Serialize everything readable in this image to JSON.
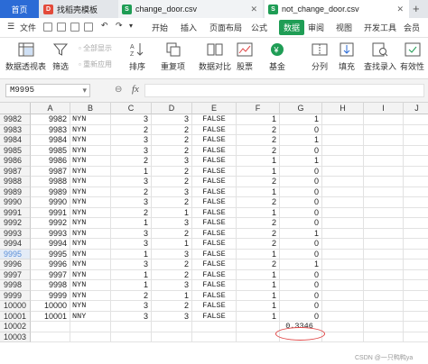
{
  "tabs": {
    "home": "首页",
    "t1": "找稻壳模板",
    "t2": "change_door.csv",
    "t3": "not_change_door.csv",
    "add": "+"
  },
  "menu": {
    "file": "文件",
    "items": [
      "开始",
      "插入",
      "页面布局",
      "公式",
      "数据",
      "审阅",
      "视图",
      "开发工具",
      "会员"
    ],
    "active_index": 4
  },
  "ribbon": {
    "pivot": "数据透视表",
    "filter": "筛选",
    "show_all": "全部显示",
    "reapply": "重新应用",
    "sort": "排序",
    "duplicates": "重复项",
    "compare": "数据对比",
    "stocks": "股票",
    "funds": "基金",
    "split": "分列",
    "fill": "填充",
    "lookup": "查找录入",
    "validity": "有效性"
  },
  "formula_bar": {
    "name_box": "M9995",
    "fx": "fx",
    "formula": ""
  },
  "columns": [
    "A",
    "B",
    "C",
    "D",
    "E",
    "F",
    "G",
    "H",
    "I",
    "J"
  ],
  "rows": [
    {
      "n": "9982",
      "a": "9982",
      "b": "NYN",
      "c": "3",
      "d": "3",
      "e": "FALSE",
      "f": "1",
      "g": "1"
    },
    {
      "n": "9983",
      "a": "9983",
      "b": "NYN",
      "c": "2",
      "d": "2",
      "e": "FALSE",
      "f": "2",
      "g": "0"
    },
    {
      "n": "9984",
      "a": "9984",
      "b": "NYN",
      "c": "3",
      "d": "2",
      "e": "FALSE",
      "f": "2",
      "g": "1"
    },
    {
      "n": "9985",
      "a": "9985",
      "b": "NYN",
      "c": "3",
      "d": "2",
      "e": "FALSE",
      "f": "2",
      "g": "0"
    },
    {
      "n": "9986",
      "a": "9986",
      "b": "NYN",
      "c": "2",
      "d": "3",
      "e": "FALSE",
      "f": "1",
      "g": "1"
    },
    {
      "n": "9987",
      "a": "9987",
      "b": "NYN",
      "c": "1",
      "d": "2",
      "e": "FALSE",
      "f": "1",
      "g": "0"
    },
    {
      "n": "9988",
      "a": "9988",
      "b": "NYN",
      "c": "3",
      "d": "2",
      "e": "FALSE",
      "f": "2",
      "g": "0"
    },
    {
      "n": "9989",
      "a": "9989",
      "b": "NYN",
      "c": "2",
      "d": "3",
      "e": "FALSE",
      "f": "1",
      "g": "0"
    },
    {
      "n": "9990",
      "a": "9990",
      "b": "NYN",
      "c": "3",
      "d": "2",
      "e": "FALSE",
      "f": "2",
      "g": "0"
    },
    {
      "n": "9991",
      "a": "9991",
      "b": "NYN",
      "c": "2",
      "d": "1",
      "e": "FALSE",
      "f": "1",
      "g": "0"
    },
    {
      "n": "9992",
      "a": "9992",
      "b": "NYN",
      "c": "1",
      "d": "3",
      "e": "FALSE",
      "f": "2",
      "g": "0"
    },
    {
      "n": "9993",
      "a": "9993",
      "b": "NYN",
      "c": "3",
      "d": "2",
      "e": "FALSE",
      "f": "2",
      "g": "1"
    },
    {
      "n": "9994",
      "a": "9994",
      "b": "NYN",
      "c": "3",
      "d": "1",
      "e": "FALSE",
      "f": "2",
      "g": "0"
    },
    {
      "n": "9995",
      "a": "9995",
      "b": "NYN",
      "c": "1",
      "d": "3",
      "e": "FALSE",
      "f": "1",
      "g": "0"
    },
    {
      "n": "9996",
      "a": "9996",
      "b": "NYN",
      "c": "3",
      "d": "2",
      "e": "FALSE",
      "f": "2",
      "g": "1"
    },
    {
      "n": "9997",
      "a": "9997",
      "b": "NYN",
      "c": "1",
      "d": "2",
      "e": "FALSE",
      "f": "1",
      "g": "0"
    },
    {
      "n": "9998",
      "a": "9998",
      "b": "NYN",
      "c": "1",
      "d": "3",
      "e": "FALSE",
      "f": "1",
      "g": "0"
    },
    {
      "n": "9999",
      "a": "9999",
      "b": "NYN",
      "c": "2",
      "d": "1",
      "e": "FALSE",
      "f": "1",
      "g": "0"
    },
    {
      "n": "10000",
      "a": "10000",
      "b": "NYN",
      "c": "3",
      "d": "2",
      "e": "FALSE",
      "f": "1",
      "g": "0"
    },
    {
      "n": "10001",
      "a": "10001",
      "b": "NNY",
      "c": "3",
      "d": "3",
      "e": "FALSE",
      "f": "1",
      "g": "0"
    },
    {
      "n": "10002",
      "a": "",
      "b": "",
      "c": "",
      "d": "",
      "e": "",
      "f": "",
      "g": "0.3346"
    },
    {
      "n": "10003",
      "a": "",
      "b": "",
      "c": "",
      "d": "",
      "e": "",
      "f": "",
      "g": ""
    }
  ],
  "selected_row": "9995",
  "highlight_value": "0.3346",
  "watermark": "CSDN @一只鸭鸭ya"
}
